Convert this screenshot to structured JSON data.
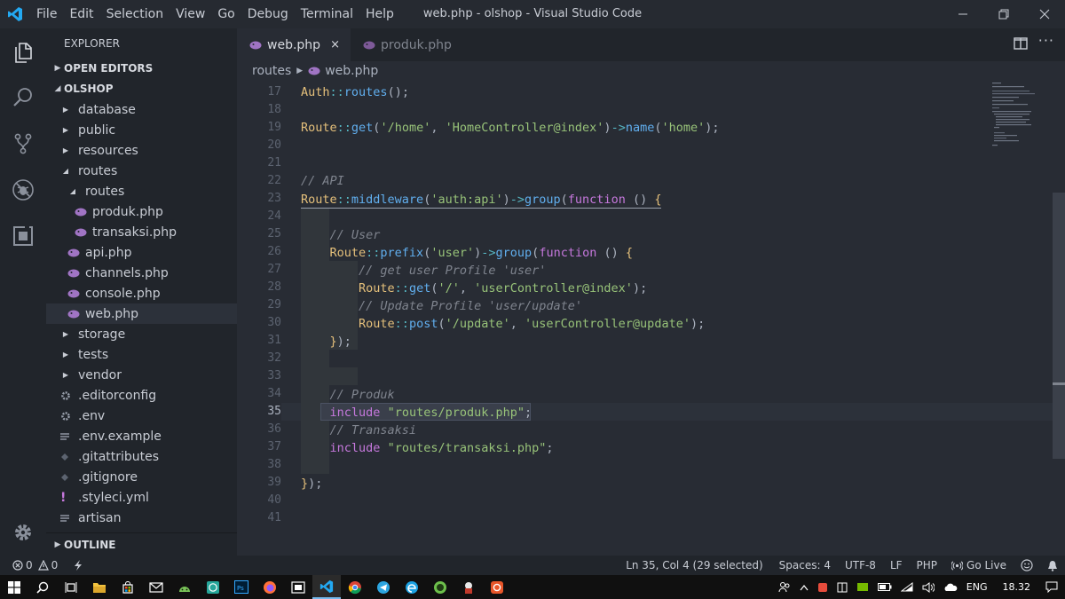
{
  "window": {
    "title": "web.php - olshop - Visual Studio Code",
    "menu": [
      "File",
      "Edit",
      "Selection",
      "View",
      "Go",
      "Debug",
      "Terminal",
      "Help"
    ]
  },
  "sidebar": {
    "title": "EXPLORER",
    "open_editors": "OPEN EDITORS",
    "project": "OLSHOP",
    "outline": "OUTLINE",
    "tree": [
      {
        "label": "database",
        "kind": "folder"
      },
      {
        "label": "public",
        "kind": "folder"
      },
      {
        "label": "resources",
        "kind": "folder"
      },
      {
        "label": "routes",
        "kind": "folder-open"
      },
      {
        "label": "routes",
        "kind": "folder-open"
      },
      {
        "label": "produk.php",
        "kind": "php"
      },
      {
        "label": "transaksi.php",
        "kind": "php"
      },
      {
        "label": "api.php",
        "kind": "php"
      },
      {
        "label": "channels.php",
        "kind": "php"
      },
      {
        "label": "console.php",
        "kind": "php"
      },
      {
        "label": "web.php",
        "kind": "php"
      },
      {
        "label": "storage",
        "kind": "folder"
      },
      {
        "label": "tests",
        "kind": "folder"
      },
      {
        "label": "vendor",
        "kind": "folder"
      },
      {
        "label": ".editorconfig",
        "kind": "gear"
      },
      {
        "label": ".env",
        "kind": "gear"
      },
      {
        "label": ".env.example",
        "kind": "lines"
      },
      {
        "label": ".gitattributes",
        "kind": "git"
      },
      {
        "label": ".gitignore",
        "kind": "git"
      },
      {
        "label": ".styleci.yml",
        "kind": "yml"
      },
      {
        "label": "artisan",
        "kind": "lines"
      }
    ]
  },
  "tabs": [
    {
      "label": "web.php",
      "active": true,
      "close": "×"
    },
    {
      "label": "produk.php",
      "active": false
    }
  ],
  "breadcrumb": {
    "folder": "routes",
    "file": "web.php"
  },
  "editor": {
    "first_line": 17,
    "current_line": 35,
    "lines": [
      [
        [
          "cls",
          "Auth"
        ],
        [
          "op",
          "::"
        ],
        [
          "fn",
          "routes"
        ],
        [
          "pn",
          "();"
        ]
      ],
      [],
      [
        [
          "cls",
          "Route"
        ],
        [
          "op",
          "::"
        ],
        [
          "fn",
          "get"
        ],
        [
          "pn",
          "("
        ],
        [
          "str",
          "'/home'"
        ],
        [
          "pn",
          ", "
        ],
        [
          "str",
          "'HomeController@index'"
        ],
        [
          "pn",
          ")"
        ],
        [
          "op",
          "->"
        ],
        [
          "fn",
          "name"
        ],
        [
          "pn",
          "("
        ],
        [
          "str",
          "'home'"
        ],
        [
          "pn",
          ");"
        ]
      ],
      [],
      [],
      [
        [
          "cm",
          "// API"
        ]
      ],
      [
        [
          "cls",
          "Route"
        ],
        [
          "op",
          "::"
        ],
        [
          "fn",
          "middleware"
        ],
        [
          "pn",
          "("
        ],
        [
          "str",
          "'auth:api'"
        ],
        [
          "pn",
          ")"
        ],
        [
          "op",
          "->"
        ],
        [
          "fn",
          "group"
        ],
        [
          "pn",
          "("
        ],
        [
          "kw",
          "function"
        ],
        [
          "pn",
          " () "
        ],
        [
          "br",
          "{"
        ]
      ],
      [],
      [
        [
          "pn",
          "    "
        ],
        [
          "cm",
          "// User"
        ]
      ],
      [
        [
          "pn",
          "    "
        ],
        [
          "cls",
          "Route"
        ],
        [
          "op",
          "::"
        ],
        [
          "fn",
          "prefix"
        ],
        [
          "pn",
          "("
        ],
        [
          "str",
          "'user'"
        ],
        [
          "pn",
          ")"
        ],
        [
          "op",
          "->"
        ],
        [
          "fn",
          "group"
        ],
        [
          "pn",
          "("
        ],
        [
          "kw",
          "function"
        ],
        [
          "pn",
          " () "
        ],
        [
          "br",
          "{"
        ]
      ],
      [
        [
          "pn",
          "        "
        ],
        [
          "cm",
          "// get user Profile 'user'"
        ]
      ],
      [
        [
          "pn",
          "        "
        ],
        [
          "cls",
          "Route"
        ],
        [
          "op",
          "::"
        ],
        [
          "fn",
          "get"
        ],
        [
          "pn",
          "("
        ],
        [
          "str",
          "'/'"
        ],
        [
          "pn",
          ", "
        ],
        [
          "str",
          "'userController@index'"
        ],
        [
          "pn",
          ");"
        ]
      ],
      [
        [
          "pn",
          "        "
        ],
        [
          "cm",
          "// Update Profile 'user/update'"
        ]
      ],
      [
        [
          "pn",
          "        "
        ],
        [
          "cls",
          "Route"
        ],
        [
          "op",
          "::"
        ],
        [
          "fn",
          "post"
        ],
        [
          "pn",
          "("
        ],
        [
          "str",
          "'/update'"
        ],
        [
          "pn",
          ", "
        ],
        [
          "str",
          "'userController@update'"
        ],
        [
          "pn",
          ");"
        ]
      ],
      [
        [
          "pn",
          "    "
        ],
        [
          "br",
          "}"
        ],
        [
          "pn",
          ");"
        ]
      ],
      [],
      [],
      [
        [
          "pn",
          "    "
        ],
        [
          "cm",
          "// Produk"
        ]
      ],
      [
        [
          "pn",
          "    "
        ],
        [
          "kw",
          "include"
        ],
        [
          "pn",
          " "
        ],
        [
          "str",
          "\"routes/produk.php\""
        ],
        [
          "pn",
          ";"
        ]
      ],
      [
        [
          "pn",
          "    "
        ],
        [
          "cm",
          "// Transaksi"
        ]
      ],
      [
        [
          "pn",
          "    "
        ],
        [
          "kw",
          "include"
        ],
        [
          "pn",
          " "
        ],
        [
          "str",
          "\"routes/transaksi.php\""
        ],
        [
          "pn",
          ";"
        ]
      ],
      [],
      [
        [
          "br",
          "}"
        ],
        [
          "pn",
          ");"
        ]
      ],
      [],
      []
    ]
  },
  "status": {
    "errors": "0",
    "warnings": "0",
    "position": "Ln 35, Col 4 (29 selected)",
    "spaces": "Spaces: 4",
    "encoding": "UTF-8",
    "eol": "LF",
    "language": "PHP",
    "golive": "Go Live"
  },
  "taskbar": {
    "language": "ENG",
    "time": "18.32"
  },
  "colors": {
    "accent": "#007acc",
    "editor_bg": "#282c34",
    "sidebar_bg": "#21252b",
    "php_icon": "#a074c4"
  }
}
